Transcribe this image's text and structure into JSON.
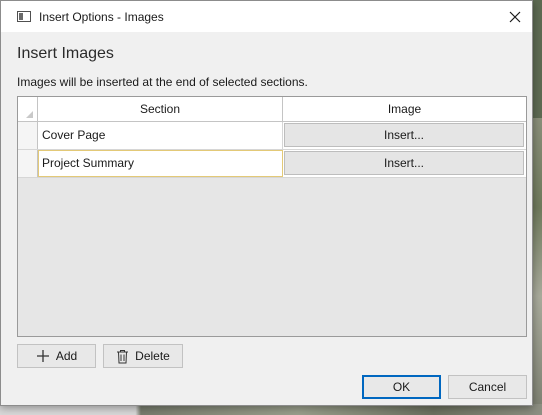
{
  "window": {
    "title": "Insert Options - Images"
  },
  "dialog": {
    "heading": "Insert Images",
    "subtext": "Images will be inserted at the end of selected sections."
  },
  "grid": {
    "columns": [
      "Section",
      "Image"
    ],
    "rows": [
      {
        "section": "Cover Page",
        "image_button": "Insert..."
      },
      {
        "section": "Project Summary",
        "image_button": "Insert..."
      }
    ],
    "selected_row": 1
  },
  "toolbar": {
    "add_label": "Add",
    "delete_label": "Delete"
  },
  "footer": {
    "ok_label": "OK",
    "cancel_label": "Cancel"
  },
  "colors": {
    "accent": "#0067c0",
    "selection_border": "#e3c977"
  },
  "icons": [
    "app-window-icon",
    "close-icon",
    "corner-triangle-icon",
    "plus-icon",
    "trash-icon"
  ]
}
